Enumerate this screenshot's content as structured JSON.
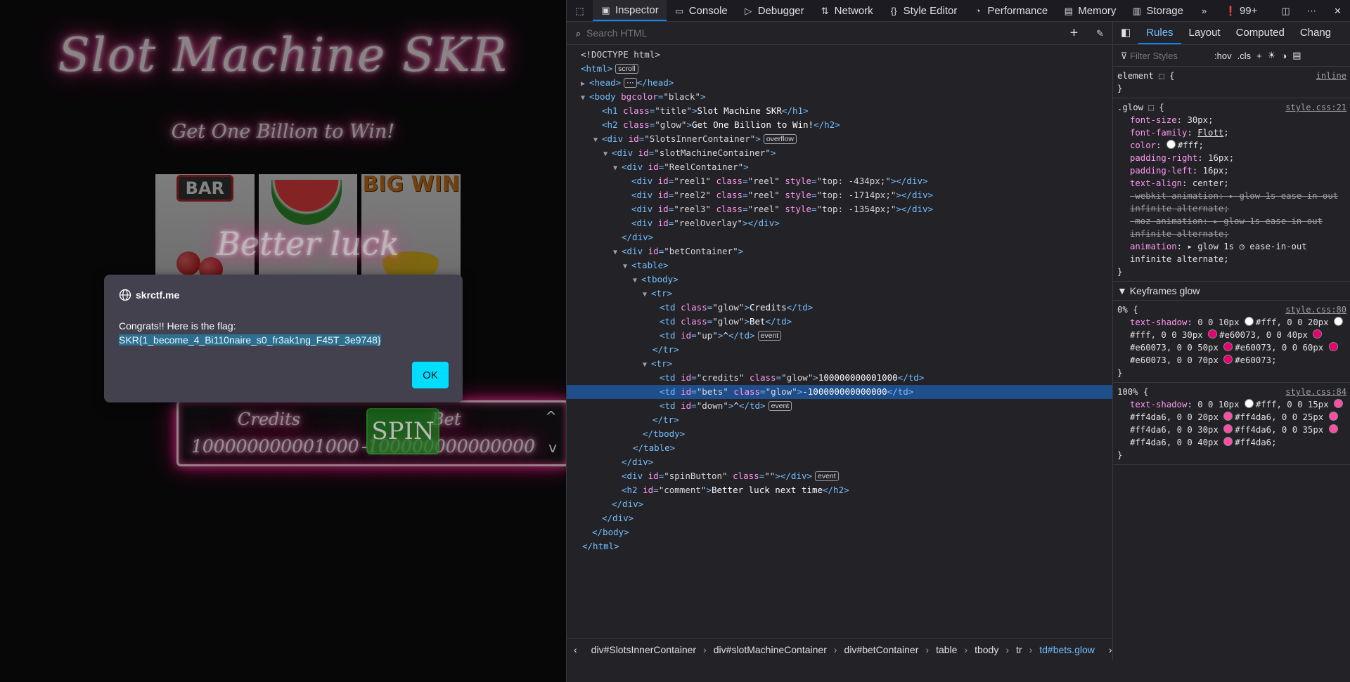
{
  "page": {
    "title": "Slot Machine SKR",
    "subtitle": "Get One Billion to Win!",
    "reel1_symbol": "BAR",
    "reel3_symbol": "BIG WIN",
    "overlay_comment": "Better luck",
    "credits_label": "Credits",
    "bet_label": "Bet",
    "credits_value": "100000000001000",
    "bets_value": "-100000000000000",
    "spin_label": "SPIN",
    "up_arrow": "^",
    "down_arrow": "v"
  },
  "dialog": {
    "origin": "skrctf.me",
    "message": "Congrats!! Here is the flag:",
    "flag": "SKR{1_become_4_Bi110naire_s0_fr3ak1ng_F45T_3e9748}",
    "ok_label": "OK"
  },
  "devtools": {
    "tabs": [
      "Inspector",
      "Console",
      "Debugger",
      "Network",
      "Style Editor",
      "Performance",
      "Memory",
      "Storage"
    ],
    "error_count": "99+",
    "search_placeholder": "Search HTML",
    "rules_tabs": [
      "Rules",
      "Layout",
      "Computed",
      "Chang"
    ],
    "filter_placeholder": "Filter Styles",
    "hov": ":hov",
    "cls": ".cls",
    "breadcrumbs": [
      "div#SlotsInnerContainer",
      "div#slotMachineContainer",
      "div#betContainer",
      "table",
      "tbody",
      "tr",
      "td#bets.glow"
    ],
    "badges": {
      "scroll": "scroll",
      "overflow": "overflow",
      "event": "event"
    },
    "element_rule": {
      "selector": "element",
      "source": "inline"
    },
    "glow_rule": {
      "selector": ".glow",
      "source": "style.css:21"
    },
    "keyframes_header": "Keyframes glow",
    "kf0": {
      "selector": "0%",
      "source": "style.css:80"
    },
    "kf100": {
      "selector": "100%",
      "source": "style.css:84"
    }
  },
  "colors": {
    "accent": "#0a84ff",
    "ok_button": "#00ddff",
    "flag_highlight": "#2d6f8f",
    "glow_pink": "#ff4da6",
    "glow_magenta": "#e60073"
  }
}
